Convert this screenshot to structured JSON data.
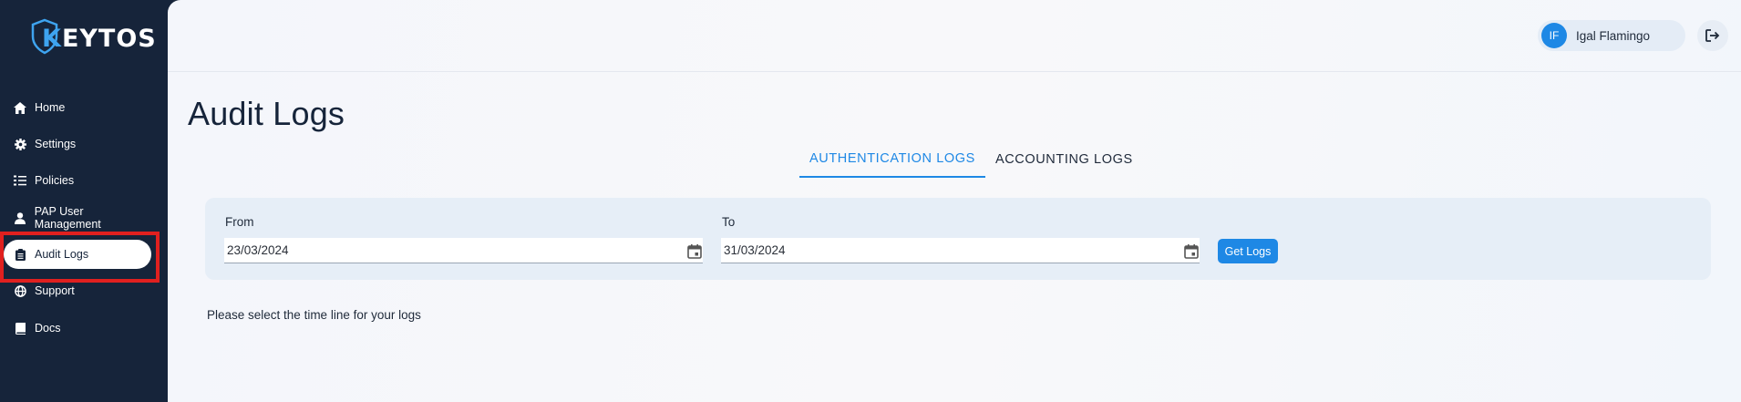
{
  "brand": {
    "logo_prefix": "K",
    "logo_rest": "EYTOS",
    "accent": "#3ea4f0"
  },
  "sidebar": {
    "items": [
      {
        "label": "Home",
        "icon": "home-icon"
      },
      {
        "label": "Settings",
        "icon": "gear-icon"
      },
      {
        "label": "Policies",
        "icon": "list-check-icon"
      },
      {
        "label": "PAP User Management",
        "icon": "user-icon"
      },
      {
        "label": "Audit Logs",
        "icon": "clipboard-icon",
        "active": true
      },
      {
        "label": "Support",
        "icon": "globe-icon"
      },
      {
        "label": "Docs",
        "icon": "book-icon"
      }
    ]
  },
  "header": {
    "user_initials": "IF",
    "user_name": "Igal Flamingo",
    "logout_icon": "logout-icon"
  },
  "page": {
    "title": "Audit Logs",
    "tabs": [
      {
        "label": "AUTHENTICATION LOGS",
        "active": true
      },
      {
        "label": "ACCOUNTING LOGS",
        "active": false
      }
    ],
    "filter": {
      "from_label": "From",
      "from_value": "23/03/2024",
      "to_label": "To",
      "to_value": "31/03/2024",
      "button_label": "Get Logs"
    },
    "hint": "Please select the time line for your logs"
  },
  "colors": {
    "sidebar_bg": "#16243a",
    "primary": "#1e88e5",
    "highlight": "#e0201f"
  }
}
